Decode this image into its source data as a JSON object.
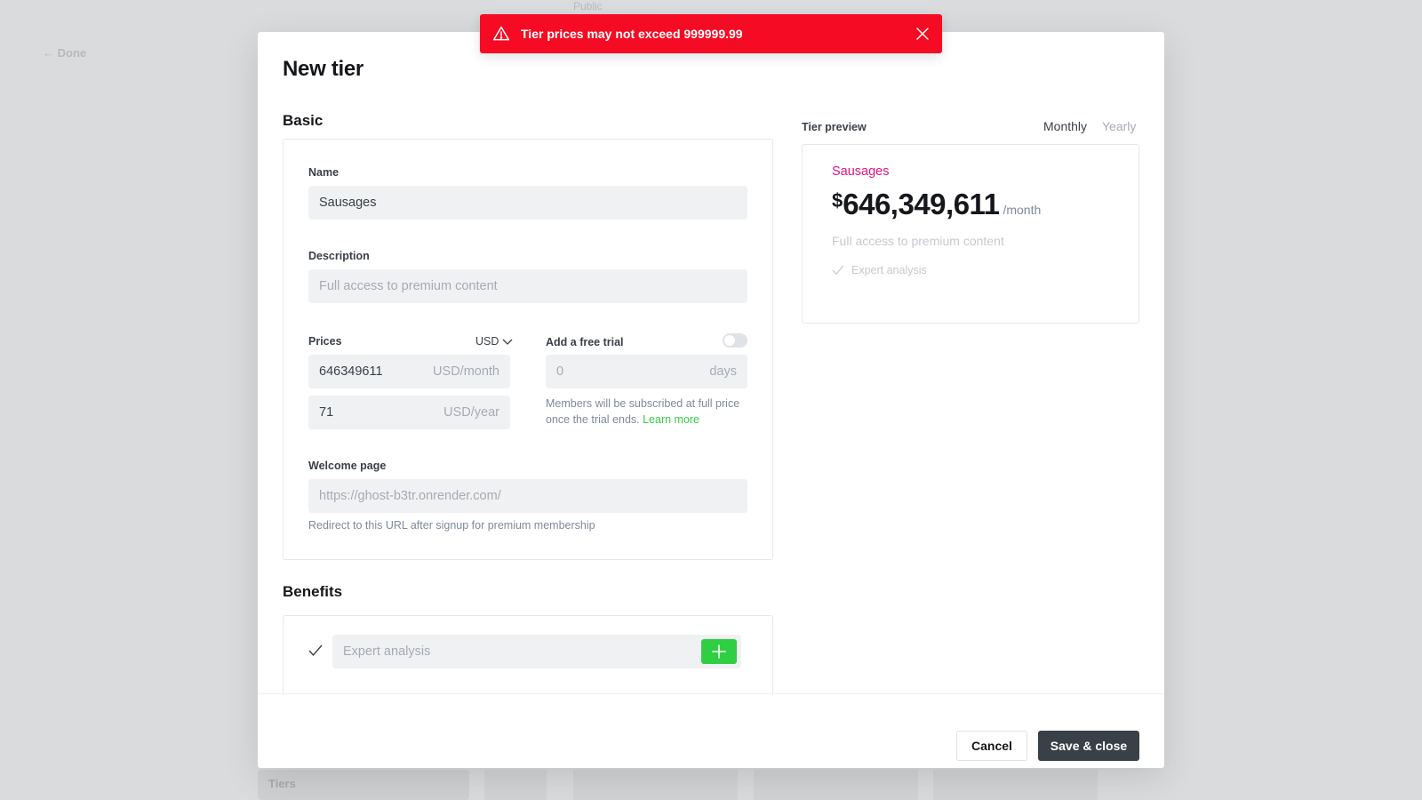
{
  "background": {
    "back_label": "← Done",
    "public_label": "Public",
    "tiers_label": "Tiers"
  },
  "toast": {
    "message": "Tier prices may not exceed 999999.99",
    "icon": "warning-icon",
    "close_icon": "close-icon",
    "color": "#f50b23"
  },
  "modal": {
    "title": "New tier",
    "basic": {
      "title": "Basic",
      "name_label": "Name",
      "name_value": "Sausages",
      "description_label": "Description",
      "description_placeholder": "Full access to premium content",
      "prices_label": "Prices",
      "currency": "USD",
      "monthly_value": "646349611",
      "monthly_suffix": "USD/month",
      "yearly_value": "71",
      "yearly_suffix": "USD/year",
      "trial_label": "Add a free trial",
      "trial_placeholder": "0",
      "trial_suffix": "days",
      "trial_hint": "Members will be subscribed at full price once the trial ends.",
      "trial_link": "Learn more",
      "welcome_label": "Welcome page",
      "welcome_placeholder": "https://ghost-b3tr.onrender.com/",
      "welcome_hint": "Redirect to this URL after signup for premium membership"
    },
    "benefits": {
      "title": "Benefits",
      "placeholder": "Expert analysis"
    },
    "preview": {
      "label": "Tier preview",
      "monthly": "Monthly",
      "yearly": "Yearly",
      "name": "Sausages",
      "currency_symbol": "$",
      "amount": "646,349,611",
      "period": "/month",
      "description": "Full access to premium content",
      "benefit": "Expert analysis"
    },
    "footer": {
      "cancel": "Cancel",
      "save": "Save & close"
    }
  },
  "colors": {
    "accent_green": "#30cf43",
    "accent_pink": "#e3137f",
    "dark_button": "#394047"
  }
}
